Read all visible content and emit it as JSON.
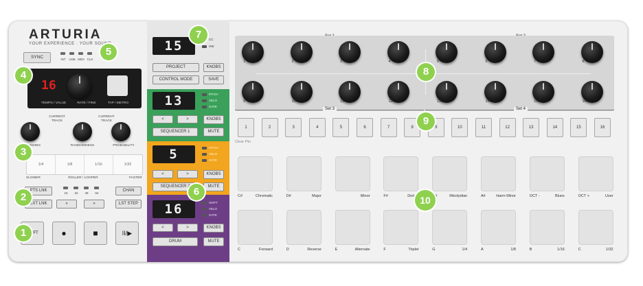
{
  "brand": {
    "name": "ARTURIA",
    "tagline": "YOUR EXPERIENCE · YOUR SOUND"
  },
  "sync": {
    "label": "SYNC",
    "leds": [
      "INT",
      "USB",
      "MIDI",
      "CLK"
    ]
  },
  "tempo_panel": {
    "display": "16",
    "tempo_label": "TEMPO / VALUE",
    "rate_label": "RATE / FINE",
    "tap_label": "TAP / METRO"
  },
  "swing_knobs": {
    "current_track_1": "CURRENT TRACK",
    "current_track_2": "CURRENT TRACK",
    "swing": "SWING",
    "randomness": "RANDOMNESS",
    "probability": "PROBABILITY"
  },
  "roller": {
    "cells": [
      "1/4",
      "1/8",
      "1/16",
      "1/32"
    ],
    "slower": "SLOWER",
    "mode": "ROLLER / LOOPER",
    "faster": "FASTER"
  },
  "chain": {
    "pts_lnk": "PTS LNK",
    "ext_lnk": "EXT LNK",
    "lengths": [
      "16",
      "32",
      "48",
      "64"
    ],
    "back": "«",
    "fwd": "»",
    "chan": "CHAN",
    "lst_step": "LST STEP"
  },
  "transport": {
    "shift": "SHIFT",
    "record": "●",
    "stop": "■",
    "play": "II/▶"
  },
  "project_block": {
    "display": "15",
    "leds": [
      "CC",
      "HW"
    ],
    "project": "PROJECT",
    "knobs": "KNOBS",
    "control_mode": "CONTROL MODE",
    "save": "SAVE"
  },
  "seq1_block": {
    "display": "13",
    "leds": [
      "PITCH",
      "VELO",
      "GATE"
    ],
    "left": "<",
    "right": ">",
    "knobs": "KNOBS",
    "name": "SEQUENCER 1",
    "mute": "MUTE"
  },
  "seq2_block": {
    "display": "5",
    "leds": [
      "PITCH",
      "VELO",
      "GATE"
    ],
    "left": "<",
    "right": ">",
    "knobs": "KNOBS",
    "name": "SEQUENCER 2",
    "mute": "MUTE"
  },
  "drum_block": {
    "display": "16",
    "leds": [
      "SHIFT",
      "VELO",
      "GATE"
    ],
    "left": "<",
    "right": ">",
    "knobs": "KNOBS",
    "name": "DRUM",
    "mute": "MUTE"
  },
  "sets": [
    "Set 1",
    "Set 2",
    "Set 3",
    "Set 4"
  ],
  "encoders": [
    "1",
    "2",
    "3",
    "4",
    "5",
    "6",
    "7",
    "8",
    "9",
    "10",
    "11",
    "12",
    "13",
    "14",
    "15",
    "16"
  ],
  "steps": [
    "1",
    "2",
    "3",
    "4",
    "5",
    "6",
    "7",
    "8",
    "9",
    "10",
    "11",
    "12",
    "13",
    "14",
    "15",
    "16"
  ],
  "clear_ptn": "Clear Ptn",
  "pads_top": [
    {
      "note": "C#",
      "name": "Chromatic"
    },
    {
      "note": "D#",
      "name": "Major"
    },
    {
      "note": "",
      "name": "Minor"
    },
    {
      "note": "F#",
      "name": "Dorian"
    },
    {
      "note": "G#",
      "name": "Mixolydian"
    },
    {
      "note": "A#",
      "name": "Harm Minor"
    },
    {
      "note": "OCT -",
      "name": "Blues"
    },
    {
      "note": "OCT +",
      "name": "User"
    }
  ],
  "pads_bottom": [
    {
      "note": "C",
      "name": "Forward"
    },
    {
      "note": "D",
      "name": "Reverse"
    },
    {
      "note": "E",
      "name": "Alternate"
    },
    {
      "note": "F",
      "name": "Triplet"
    },
    {
      "note": "G",
      "name": "1/4"
    },
    {
      "note": "A",
      "name": "1/8"
    },
    {
      "note": "B",
      "name": "1/16"
    },
    {
      "note": "C",
      "name": "1/32"
    }
  ],
  "badges": [
    "1",
    "2",
    "3",
    "4",
    "5",
    "6",
    "7",
    "8",
    "9",
    "10"
  ],
  "colors": {
    "green_badge": "#8fd14f",
    "seq1_green": "#3aa05a",
    "seq2_orange": "#f2a51e",
    "drum_purple": "#6d3e86",
    "led_red": "#e02020"
  }
}
